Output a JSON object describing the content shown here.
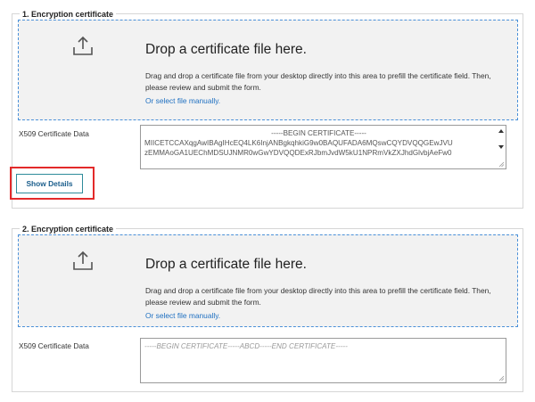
{
  "sections": [
    {
      "title": "1. Encryption certificate",
      "dropzone": {
        "heading": "Drop a certificate file here.",
        "description": "Drag and drop a certificate file from your desktop directly into this area to prefill the certificate field. Then, please review and submit the form.",
        "link": "Or select file manually."
      },
      "field_label": "X509 Certificate Data",
      "cert_lines": [
        "-----BEGIN CERTIFICATE-----",
        "MIICETCCAXqgAwIBAgIHcEQ4LK6InjANBgkqhkiG9w0BAQUFADA6MQswCQYDVQQGEwJVU",
        "zEMMAoGA1UEChMDSUJNMR0wGwYDVQQDExRJbmJvdW5kU1NPRmVkZXJhdGlvbjAeFw0"
      ],
      "button_label": "Show Details"
    },
    {
      "title": "2. Encryption certificate",
      "dropzone": {
        "heading": "Drop a certificate file here.",
        "description": "Drag and drop a certificate file from your desktop directly into this area to prefill the certificate field. Then, please review and submit the form.",
        "link": "Or select file manually."
      },
      "field_label": "X509 Certificate Data",
      "placeholder": "-----BEGIN CERTIFICATE-----ABCD-----END CERTIFICATE-----"
    }
  ],
  "colors": {
    "dropzone_border": "#4a90d9",
    "link": "#1f70c1",
    "button_border": "#2e8b9a",
    "button_text": "#1b5e8c",
    "highlight": "#e32a2a"
  },
  "icons": [
    "upload-icon",
    "resize-grip-icon"
  ]
}
